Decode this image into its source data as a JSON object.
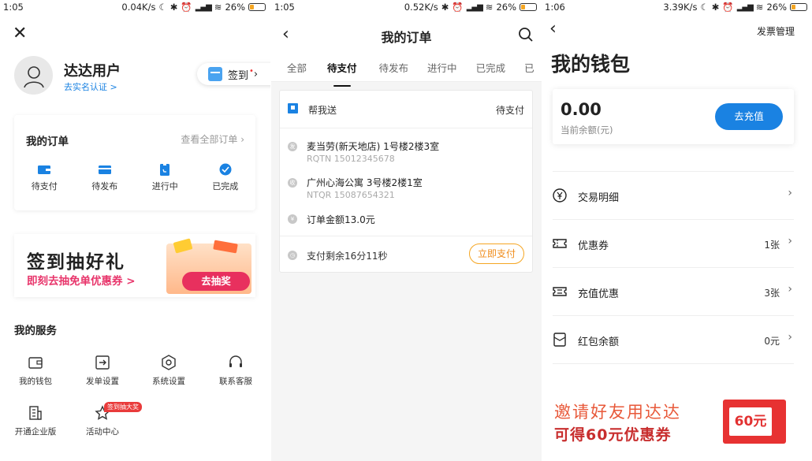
{
  "status_bars": [
    {
      "time": "1:05",
      "speed": "0.04K/s",
      "battery": "26%"
    },
    {
      "time": "1:05",
      "speed": "0.52K/s",
      "battery": "26%"
    },
    {
      "time": "1:06",
      "speed": "3.39K/s",
      "battery": "26%"
    }
  ],
  "profile": {
    "username": "达达用户",
    "verify_link": "去实名认证 >",
    "signin_label": "签到"
  },
  "orders_card": {
    "title": "我的订单",
    "see_all": "查看全部订单",
    "items": [
      {
        "label": "待支付",
        "icon": "wallet-icon"
      },
      {
        "label": "待发布",
        "icon": "card-icon"
      },
      {
        "label": "进行中",
        "icon": "clipboard-icon"
      },
      {
        "label": "已完成",
        "icon": "check-circle-icon"
      }
    ]
  },
  "promo_banner": {
    "title": "签到抽好礼",
    "subtitle": "即刻去抽免单优惠券 >",
    "button": "去抽奖"
  },
  "services": {
    "title": "我的服务",
    "items": [
      {
        "label": "我的钱包",
        "icon": "wallet-icon"
      },
      {
        "label": "发单设置",
        "icon": "send-icon"
      },
      {
        "label": "系统设置",
        "icon": "gear-icon"
      },
      {
        "label": "联系客服",
        "icon": "headset-icon"
      },
      {
        "label": "开通企业版",
        "icon": "building-icon"
      },
      {
        "label": "活动中心",
        "icon": "star-icon"
      }
    ],
    "badge": "签到抽大奖"
  },
  "my_orders": {
    "title": "我的订单",
    "tabs": [
      "全部",
      "待支付",
      "待发布",
      "进行中",
      "已完成",
      "已"
    ],
    "active_tab": "待支付",
    "order": {
      "type": "帮我送",
      "status": "待支付",
      "from_address": "麦当劳(新天地店) 1号楼2楼3室",
      "from_contact": "RQTN  15012345678",
      "to_address": "广州心海公寓 3号楼2楼1室",
      "to_contact": "NTQR  15087654321",
      "amount": "订单金额13.0元",
      "remaining": "支付剩余16分11秒",
      "pay_button": "立即支付"
    }
  },
  "wallet": {
    "invoice": "发票管理",
    "title": "我的钱包",
    "balance": "0.00",
    "balance_label": "当前余额(元)",
    "recharge": "去充值",
    "rows": [
      {
        "label": "交易明细",
        "value": "",
        "icon": "yen-icon"
      },
      {
        "label": "优惠券",
        "value": "1张",
        "icon": "coupon-icon"
      },
      {
        "label": "充值优惠",
        "value": "3张",
        "icon": "ticket-icon"
      },
      {
        "label": "红包余额",
        "value": "0元",
        "icon": "red-envelope-icon"
      }
    ],
    "invite_line1": "邀请好友用达达",
    "invite_line2": "可得60元优惠券",
    "envelope_amount": "60元"
  },
  "colors": {
    "accent": "#1a82e2",
    "pay_orange": "#f5a623",
    "promo_pink": "#e8305e",
    "invite_red": "#e23030"
  }
}
